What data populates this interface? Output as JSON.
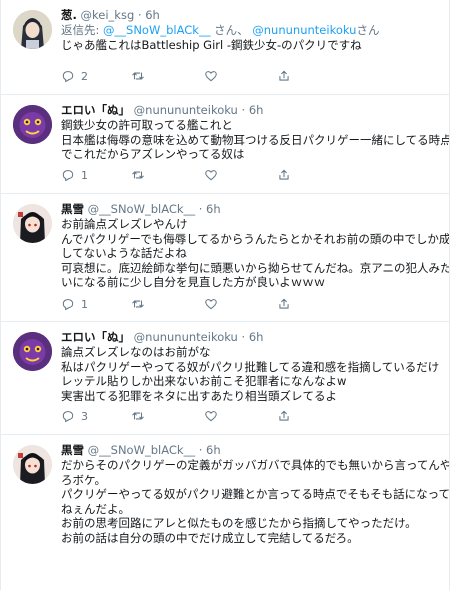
{
  "tweets": [
    {
      "name": "葱.",
      "handle": "@kei_ksg",
      "dot": "·",
      "time": "6h",
      "replying_prefix": "返信先: ",
      "replying_mention_1": "@__SNoW_blACk__",
      "replying_mid": " さん、 ",
      "replying_mention_2": "@nunununteikoku",
      "replying_suffix": "さん",
      "lines": [
        "じゃあ艦これはBattleship Girl -鋼鉄少女-のパクリですね"
      ],
      "reply_count": "2",
      "retweet_count": "",
      "like_count": ""
    },
    {
      "name": "エロい「ぬ」",
      "handle": "@nunununteikoku",
      "dot": "·",
      "time": "6h",
      "lines": [
        "鋼鉄少女の許可取ってる艦これと",
        "日本艦は侮辱の意味を込めて動物耳つける反日パクリゲー一緒にしてる時点",
        "でこれだからアズレンやってる奴は"
      ],
      "reply_count": "1",
      "retweet_count": "",
      "like_count": ""
    },
    {
      "name": "黒雪",
      "handle": "@__SNoW_blACk__",
      "dot": "·",
      "time": "6h",
      "lines": [
        "お前論点ズレズレやんけ",
        "んでパクリゲーでも侮辱してるからうんたらとかそれお前の頭の中でしか成立",
        "してないような話だよね",
        "可哀想に。底辺絵師な挙句に頭悪いから拗らせてんだね。京アニの犯人みた",
        "いになる前に少し自分を見直した方が良いよｗｗｗ"
      ],
      "reply_count": "1",
      "retweet_count": "",
      "like_count": ""
    },
    {
      "name": "エロい「ぬ」",
      "handle": "@nunununteikoku",
      "dot": "·",
      "time": "6h",
      "lines": [
        "論点ズレズレなのはお前がな",
        "私はパクリゲーやってる奴がパクリ批難してる違和感を指摘しているだけ",
        "レッテル貼りしか出来ないお前こそ犯罪者になんなよw",
        "実害出てる犯罪をネタに出すあたり相当頭ズレてるよ"
      ],
      "reply_count": "3",
      "retweet_count": "",
      "like_count": ""
    },
    {
      "name": "黒雪",
      "handle": "@__SNoW_blACk__",
      "dot": "·",
      "time": "6h",
      "lines": [
        "だからそのパクリゲーの定義がガッバガバで具体的でも無いから言ってんや",
        "ろボケ。",
        "パクリゲーやってる奴がパクリ避難とか言ってる時点でそもそも話になって",
        "ねぇんだよ。",
        "お前の思考回路にアレと似たものを感じたから指摘してやっただけ。",
        "お前の話は自分の頭の中でだけ成立して完結してるだろ。"
      ],
      "reply_count": "",
      "retweet_count": "",
      "like_count": ""
    }
  ]
}
